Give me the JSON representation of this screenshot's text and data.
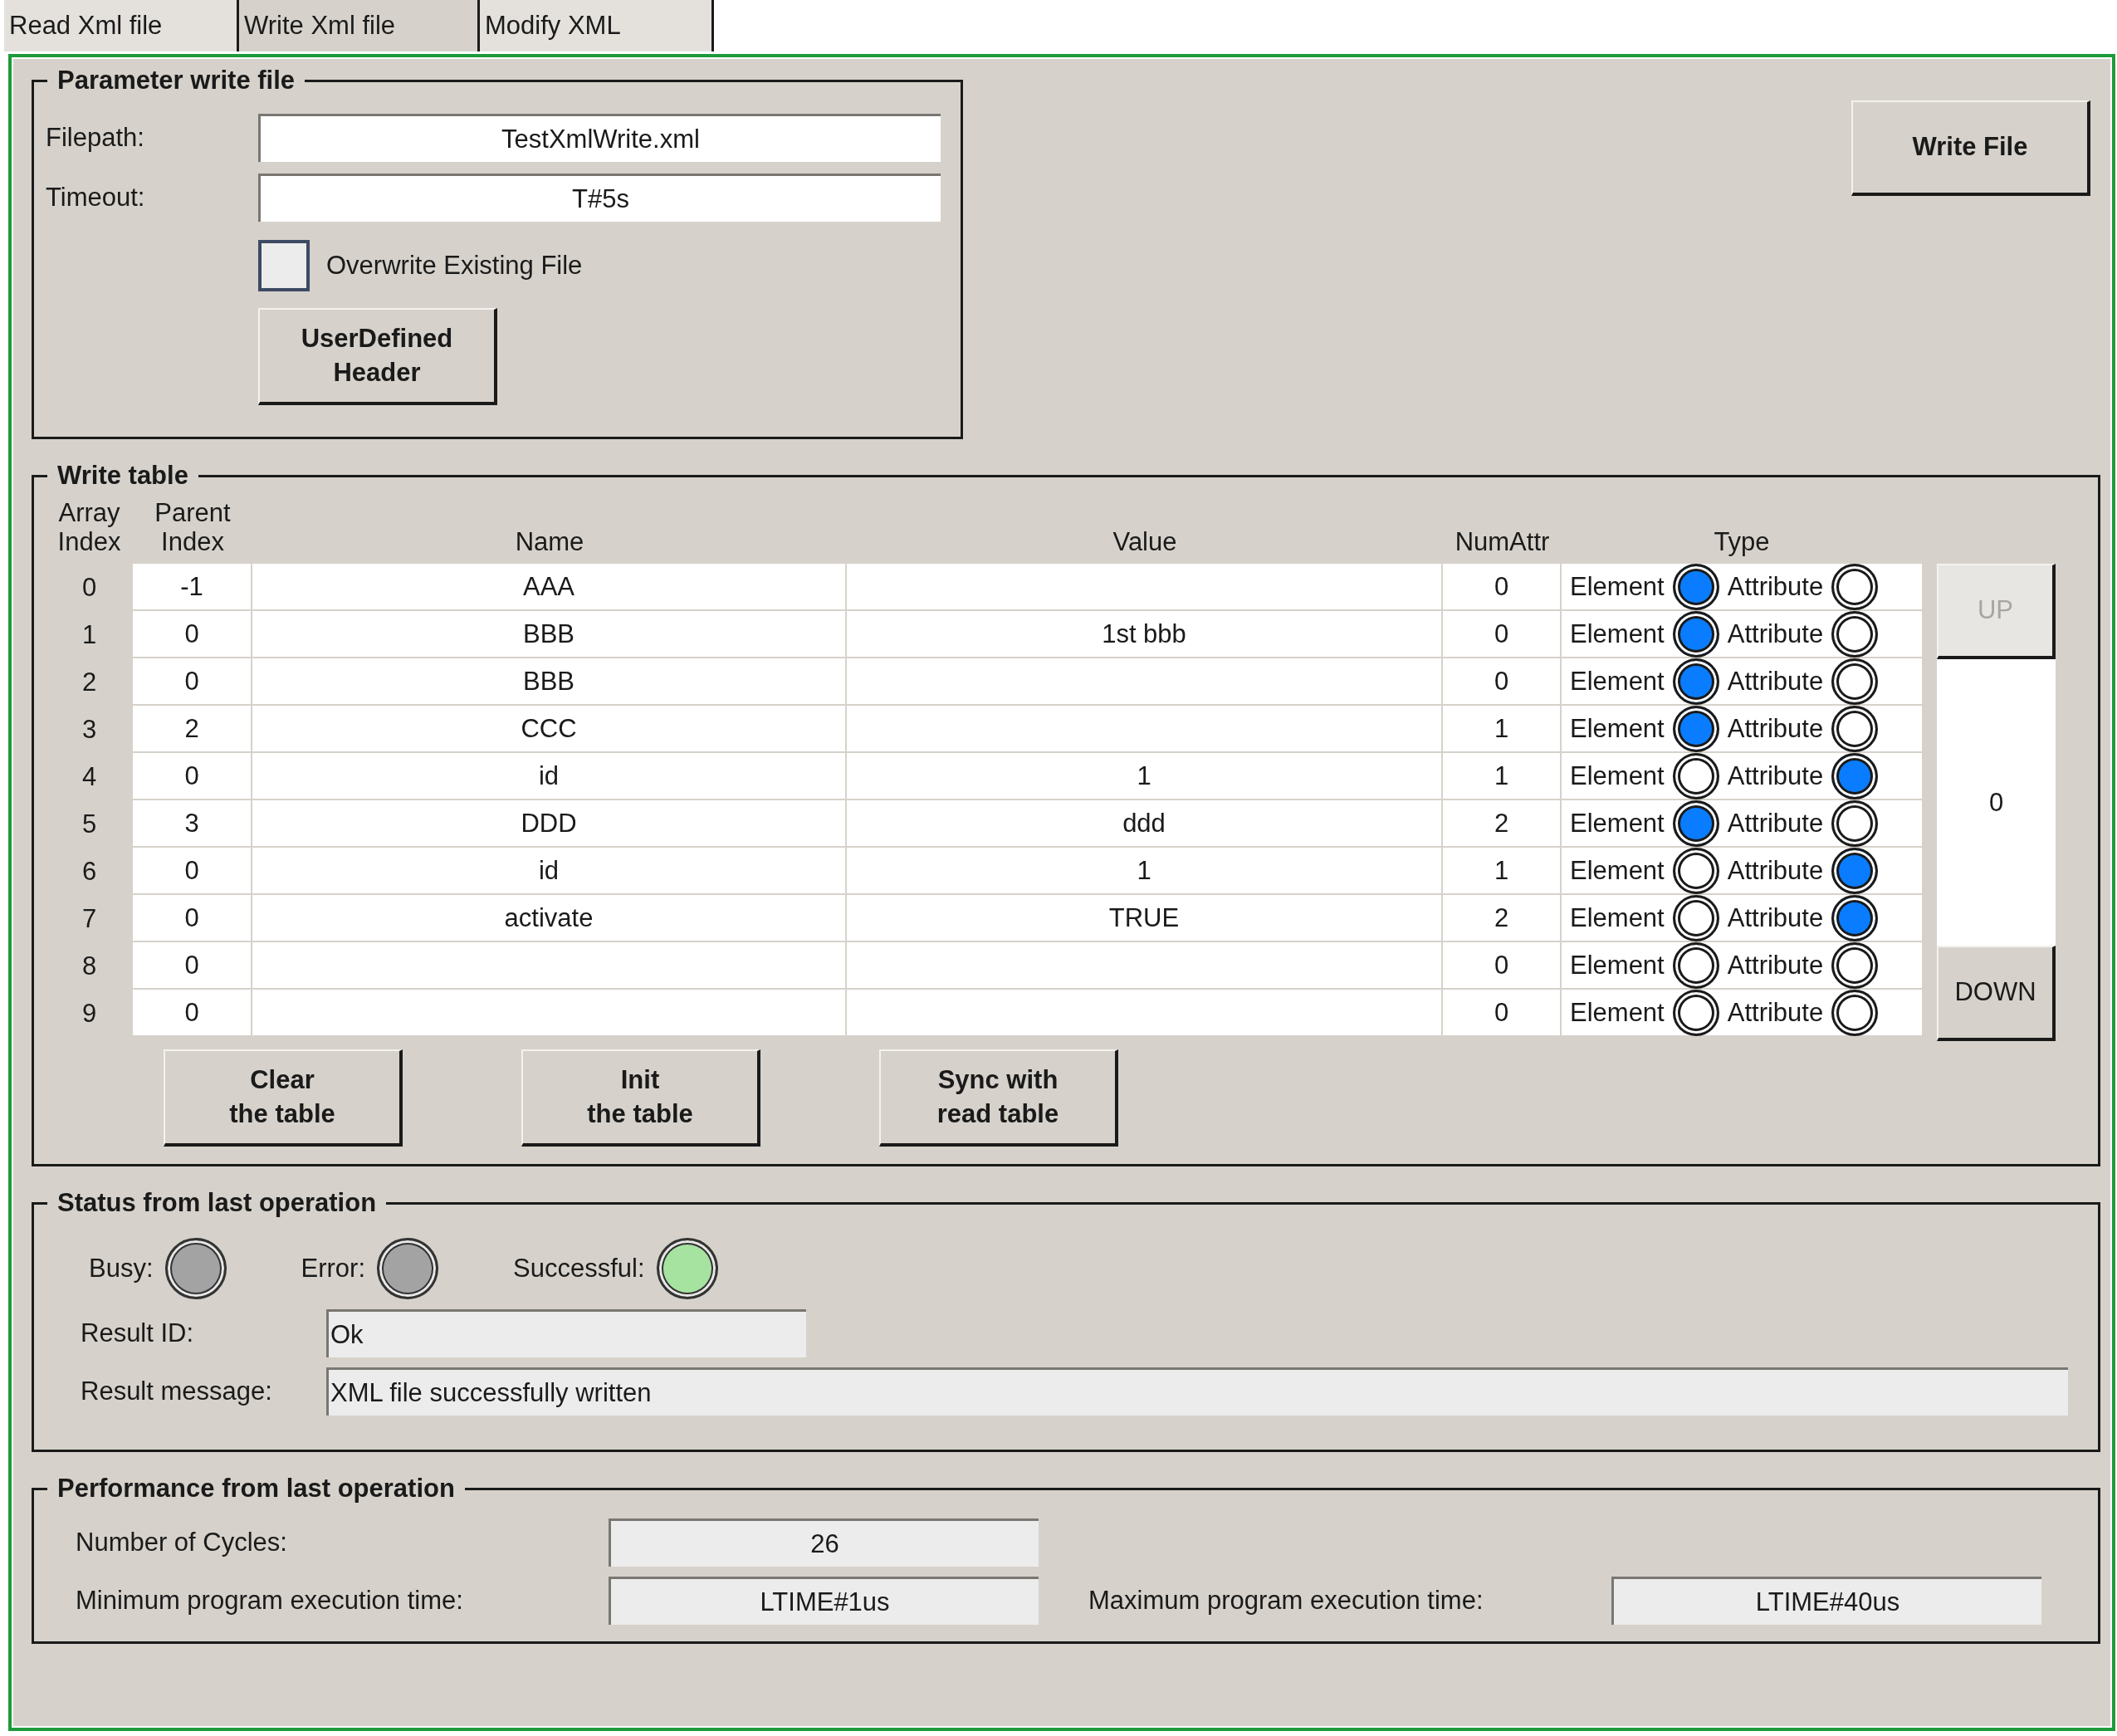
{
  "tabs": [
    {
      "label": "Read Xml file",
      "selected": false
    },
    {
      "label": "Write Xml file",
      "selected": true
    },
    {
      "label": "Modify XML",
      "selected": false
    }
  ],
  "parameter_group": {
    "title": "Parameter write file",
    "fields": [
      {
        "label": "Filepath:",
        "value": "TestXmlWrite.xml"
      },
      {
        "label": "Timeout:",
        "value": "T#5s"
      }
    ],
    "overwrite": {
      "label": "Overwrite Existing File",
      "checked": false
    },
    "header_button": "UserDefined\nHeader"
  },
  "write_button": "Write File",
  "write_table": {
    "title": "Write table",
    "columns": [
      "Array\nIndex",
      "Parent\nIndex",
      "Name",
      "Value",
      "NumAttr",
      "Type"
    ],
    "rows": [
      {
        "index": "0",
        "parent": "-1",
        "name": "AAA",
        "num_attr": "0",
        "radios": [
          {
            "label": "Element",
            "selected": true
          },
          {
            "label": "Attribute",
            "selected": false
          }
        ]
      },
      {
        "index": "1",
        "parent": "0",
        "name": "BBB",
        "value": "1st bbb",
        "num_attr": "0",
        "radios": [
          {
            "label": "Element",
            "selected": true
          },
          {
            "label": "Attribute",
            "selected": false
          }
        ]
      },
      {
        "index": "2",
        "parent": "0",
        "name": "BBB",
        "num_attr": "0",
        "radios": [
          {
            "label": "Element",
            "selected": true
          },
          {
            "label": "Attribute",
            "selected": false
          }
        ]
      },
      {
        "index": "3",
        "parent": "2",
        "name": "CCC",
        "num_attr": "1",
        "radios": [
          {
            "label": "Element",
            "selected": true
          },
          {
            "label": "Attribute",
            "selected": false
          }
        ]
      },
      {
        "index": "4",
        "parent": "0",
        "name": "id",
        "value": "1",
        "num_attr": "1",
        "radios": [
          {
            "label": "Element",
            "selected": false
          },
          {
            "label": "Attribute",
            "selected": true
          }
        ]
      },
      {
        "index": "5",
        "parent": "3",
        "name": "DDD",
        "value": "ddd",
        "num_attr": "2",
        "radios": [
          {
            "label": "Element",
            "selected": true
          },
          {
            "label": "Attribute",
            "selected": false
          }
        ]
      },
      {
        "index": "6",
        "parent": "0",
        "name": "id",
        "value": "1",
        "num_attr": "1",
        "radios": [
          {
            "label": "Element",
            "selected": false
          },
          {
            "label": "Attribute",
            "selected": true
          }
        ]
      },
      {
        "index": "7",
        "parent": "0",
        "name": "activate",
        "value": "TRUE",
        "num_attr": "2",
        "radios": [
          {
            "label": "Element",
            "selected": false
          },
          {
            "label": "Attribute",
            "selected": true
          }
        ]
      },
      {
        "index": "8",
        "parent": "0",
        "num_attr": "0",
        "radios": [
          {
            "label": "Element",
            "selected": false
          },
          {
            "label": "Attribute",
            "selected": false
          }
        ]
      },
      {
        "index": "9",
        "parent": "0",
        "num_attr": "0",
        "radios": [
          {
            "label": "Element",
            "selected": false
          },
          {
            "label": "Attribute",
            "selected": false
          }
        ]
      }
    ],
    "scroller": {
      "up": {
        "label": "UP",
        "disabled": true
      },
      "value": "0",
      "down": {
        "label": "DOWN",
        "disabled": false
      }
    },
    "buttons": [
      "Clear\nthe table",
      "Init\nthe table",
      "Sync with\nread table"
    ]
  },
  "status_group": {
    "title": "Status from last operation",
    "leds": [
      {
        "label": "Busy:",
        "color": "#a3a3a3"
      },
      {
        "label": "Error:",
        "color": "#a3a3a3"
      },
      {
        "label": "Successful:",
        "color": "#a6e3a0"
      }
    ],
    "result_id": {
      "label": "Result ID:",
      "value": "Ok"
    },
    "result_message": {
      "label": "Result message:",
      "value": "XML file successfully written"
    }
  },
  "performance_group": {
    "title": "Performance from last operation",
    "cycles": {
      "label": "Number of Cycles:",
      "value": "26"
    },
    "min_time": {
      "label": "Minimum program execution time:",
      "value": "LTIME#1us"
    },
    "max_time": {
      "label": "Maximum program execution time:",
      "value": "LTIME#40us"
    }
  }
}
